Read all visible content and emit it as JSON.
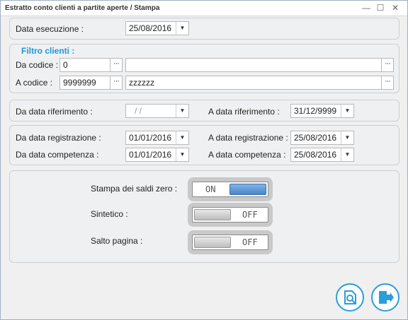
{
  "window": {
    "title": "Estratto conto clienti a partite aperte / Stampa"
  },
  "exec": {
    "label": "Data esecuzione :",
    "value": "25/08/2016"
  },
  "filter": {
    "title": "Filtro clienti :",
    "from_label": "Da codice :",
    "from_code": "0",
    "from_desc": "",
    "to_label": "A codice :",
    "to_code": "9999999",
    "to_desc": "zzzzzz",
    "dots": "···"
  },
  "reference": {
    "from_label": "Da data riferimento :",
    "from_value": "/ /",
    "to_label": "A data riferimento :",
    "to_value": "31/12/9999"
  },
  "registration": {
    "from_label": "Da data registrazione :",
    "from_value": "01/01/2016",
    "to_label": "A data registrazione :",
    "to_value": "25/08/2016"
  },
  "competence": {
    "from_label": "Da data competenza :",
    "from_value": "01/01/2016",
    "to_label": "A data competenza :",
    "to_value": "25/08/2016"
  },
  "options": {
    "zero_label": "Stampa dei saldi zero :",
    "zero_state": "ON",
    "synthetic_label": "Sintetico :",
    "synthetic_state": "OFF",
    "pagebreak_label": "Salto pagina :",
    "pagebreak_state": "OFF"
  },
  "colors": {
    "accent": "#2a9ed8",
    "toggle_on": "#4b86c9"
  },
  "icons": {
    "preview": "preview-icon",
    "exit": "exit-icon",
    "dropdown": "chevron-down-icon"
  }
}
